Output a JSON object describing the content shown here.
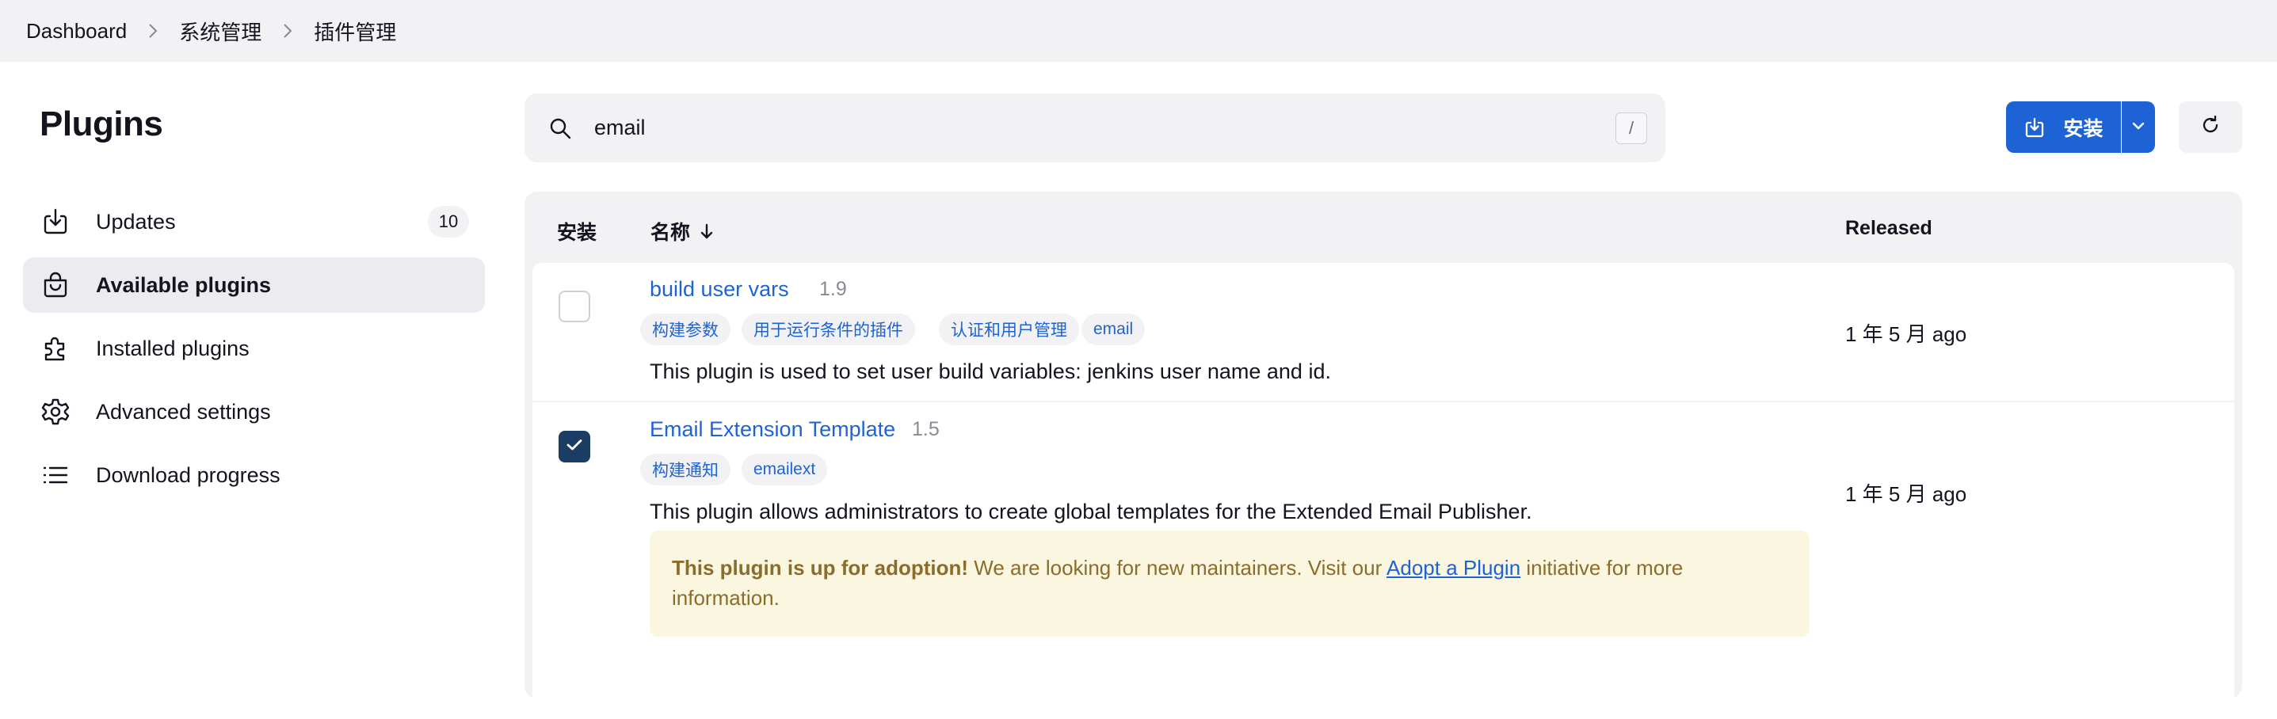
{
  "breadcrumb": {
    "items": [
      "Dashboard",
      "系统管理",
      "插件管理"
    ]
  },
  "sidebar": {
    "title": "Plugins",
    "items": [
      {
        "label": "Updates",
        "icon": "download-icon",
        "badge": "10"
      },
      {
        "label": "Available plugins",
        "icon": "shopping-bag-icon",
        "active": true
      },
      {
        "label": "Installed plugins",
        "icon": "puzzle-icon"
      },
      {
        "label": "Advanced settings",
        "icon": "gear-icon"
      },
      {
        "label": "Download progress",
        "icon": "list-icon"
      }
    ]
  },
  "search": {
    "value": "email",
    "shortcut": "/"
  },
  "toolbar": {
    "install_label": "安装"
  },
  "table": {
    "headers": {
      "install": "安装",
      "name": "名称",
      "released": "Released"
    },
    "rows": [
      {
        "name": "build user vars",
        "version": "1.9",
        "tags": [
          "构建参数",
          "用于运行条件的插件",
          "认证和用户管理",
          "email"
        ],
        "description": "This plugin is used to set user build variables: jenkins user name and id.",
        "released": "1 年 5 月 ago",
        "checked": false
      },
      {
        "name": "Email Extension Template",
        "version": "1.5",
        "tags": [
          "构建通知",
          "emailext"
        ],
        "description": "This plugin allows administrators to create global templates for the Extended Email Publisher.",
        "released": "1 年 5 月 ago",
        "checked": true,
        "adoption": {
          "bold": "This plugin is up for adoption!",
          "text1": " We are looking for new maintainers. Visit our ",
          "link": "Adopt a Plugin",
          "text2": " initiative for more information."
        }
      }
    ]
  },
  "colors": {
    "accent": "#1e63d6",
    "checked": "#1b3d63",
    "adoption_bg": "#faf6df",
    "adoption_text": "#8a6d2c"
  }
}
